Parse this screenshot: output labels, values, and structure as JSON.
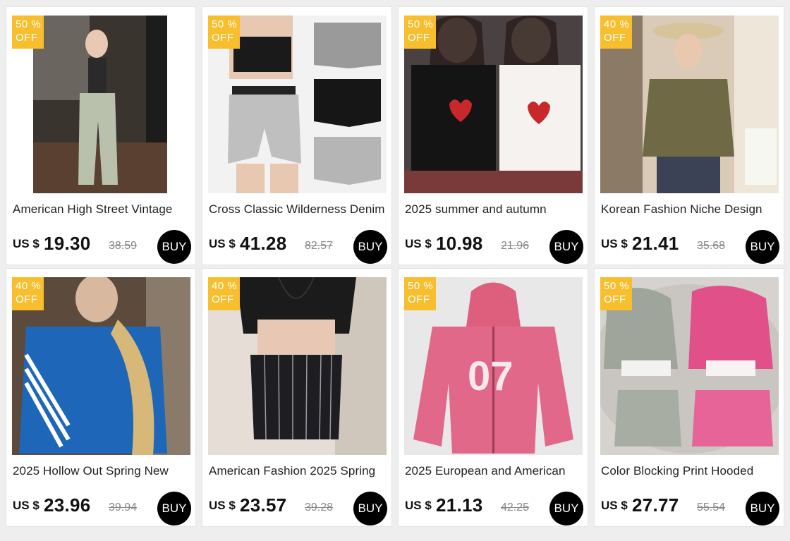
{
  "products": [
    {
      "title": "American High Street Vintage",
      "currency": "US $",
      "price": "19.30",
      "old_price": "38.59",
      "discount_pct": "50 %",
      "discount_off": "OFF",
      "buy_label": "BUY",
      "image": "woman-in-ripped-jeans-photo"
    },
    {
      "title": "Cross Classic Wilderness Denim",
      "currency": "US $",
      "price": "41.28",
      "old_price": "82.57",
      "discount_pct": "50 %",
      "discount_off": "OFF",
      "buy_label": "BUY",
      "image": "denim-shorts-photo"
    },
    {
      "title": "2025 summer and autumn",
      "currency": "US $",
      "price": "10.98",
      "old_price": "21.96",
      "discount_pct": "50 %",
      "discount_off": "OFF",
      "buy_label": "BUY",
      "image": "i-love-me-tank-tops-photo"
    },
    {
      "title": "Korean Fashion Niche Design",
      "currency": "US $",
      "price": "21.41",
      "old_price": "35.68",
      "discount_pct": "40 %",
      "discount_off": "OFF",
      "buy_label": "BUY",
      "image": "knit-polo-top-photo"
    },
    {
      "title": "2025 Hollow Out Spring New",
      "currency": "US $",
      "price": "23.96",
      "old_price": "39.94",
      "discount_pct": "40 %",
      "discount_off": "OFF",
      "buy_label": "BUY",
      "image": "blue-knit-cardigan-photo"
    },
    {
      "title": "American Fashion 2025 Spring",
      "currency": "US $",
      "price": "23.57",
      "old_price": "39.28",
      "discount_pct": "40 %",
      "discount_off": "OFF",
      "buy_label": "BUY",
      "image": "pinstripe-corset-top-photo"
    },
    {
      "title": "2025 European and American",
      "currency": "US $",
      "price": "21.13",
      "old_price": "42.25",
      "discount_pct": "50 %",
      "discount_off": "OFF",
      "buy_label": "BUY",
      "image": "pink-07-hoodie-photo"
    },
    {
      "title": "Color Blocking Print Hooded",
      "currency": "US $",
      "price": "27.77",
      "old_price": "55.54",
      "discount_pct": "50 %",
      "discount_off": "OFF",
      "buy_label": "BUY",
      "image": "camo-hoodie-shorts-set-photo"
    }
  ],
  "colors": {
    "badge": "#f7be2e",
    "buy_button": "#000000",
    "page_bg": "#eeeeee"
  }
}
